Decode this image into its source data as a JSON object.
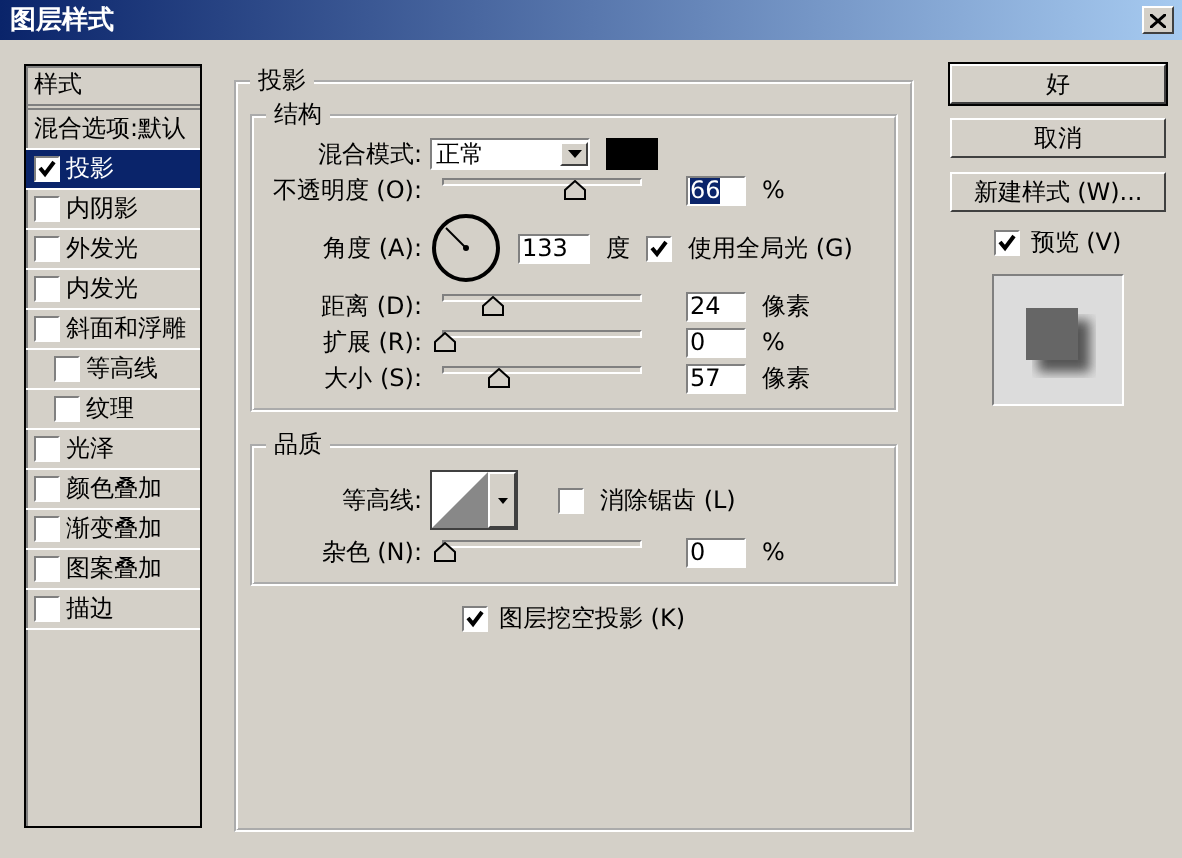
{
  "window": {
    "title": "图层样式"
  },
  "sidebar": {
    "header": "样式",
    "items": [
      {
        "label": "混合选项:默认",
        "kind": "plain",
        "selected": false
      },
      {
        "label": "投影",
        "kind": "check",
        "checked": true,
        "selected": true
      },
      {
        "label": "内阴影",
        "kind": "check",
        "checked": false,
        "selected": false
      },
      {
        "label": "外发光",
        "kind": "check",
        "checked": false,
        "selected": false
      },
      {
        "label": "内发光",
        "kind": "check",
        "checked": false,
        "selected": false
      },
      {
        "label": "斜面和浮雕",
        "kind": "check",
        "checked": false,
        "selected": false,
        "children": [
          {
            "label": "等高线",
            "kind": "check",
            "checked": false,
            "selected": false
          },
          {
            "label": "纹理",
            "kind": "check",
            "checked": false,
            "selected": false
          }
        ]
      },
      {
        "label": "光泽",
        "kind": "check",
        "checked": false,
        "selected": false
      },
      {
        "label": "颜色叠加",
        "kind": "check",
        "checked": false,
        "selected": false
      },
      {
        "label": "渐变叠加",
        "kind": "check",
        "checked": false,
        "selected": false
      },
      {
        "label": "图案叠加",
        "kind": "check",
        "checked": false,
        "selected": false
      },
      {
        "label": "描边",
        "kind": "check",
        "checked": false,
        "selected": false
      }
    ]
  },
  "panel": {
    "title": "投影",
    "structure": {
      "title": "结构",
      "rows": [
        {
          "kind": "select",
          "label": "混合模式:",
          "value": "正常"
        },
        {
          "kind": "slider",
          "label": "不透明度 (O):",
          "level": 0.66,
          "value": "66",
          "value_selected": true,
          "unit": "%"
        },
        {
          "kind": "angle",
          "label": "角度 (A):",
          "value": "133",
          "unit": "度",
          "checkbox": {
            "label": "使用全局光 (G)",
            "checked": true
          }
        },
        {
          "kind": "slider",
          "label": "距离 (D):",
          "level": 0.24,
          "value": "24",
          "value_selected": false,
          "unit": "像素"
        },
        {
          "kind": "slider",
          "label": "扩展 (R):",
          "level": 0,
          "value": "0",
          "value_selected": false,
          "unit": "%"
        },
        {
          "kind": "slider",
          "label": "大小 (S):",
          "level": 0.28,
          "value": "57",
          "value_selected": false,
          "unit": "像素"
        }
      ]
    },
    "quality": {
      "title": "品质",
      "contour": {
        "label": "等高线:",
        "antialias": {
          "label": "消除锯齿 (L)",
          "checked": false
        }
      },
      "rows": [
        {
          "kind": "slider",
          "label": "杂色 (N):",
          "level": 0,
          "value": "0",
          "value_selected": false,
          "unit": "%"
        }
      ]
    },
    "knockout": {
      "label": "图层挖空投影 (K)",
      "checked": true
    }
  },
  "buttons": [
    {
      "label": "好",
      "default": true
    },
    {
      "label": "取消",
      "default": false
    },
    {
      "label": "新建样式 (W)...",
      "default": false
    }
  ],
  "preview": {
    "label": "预览 (V)",
    "checked": true
  }
}
